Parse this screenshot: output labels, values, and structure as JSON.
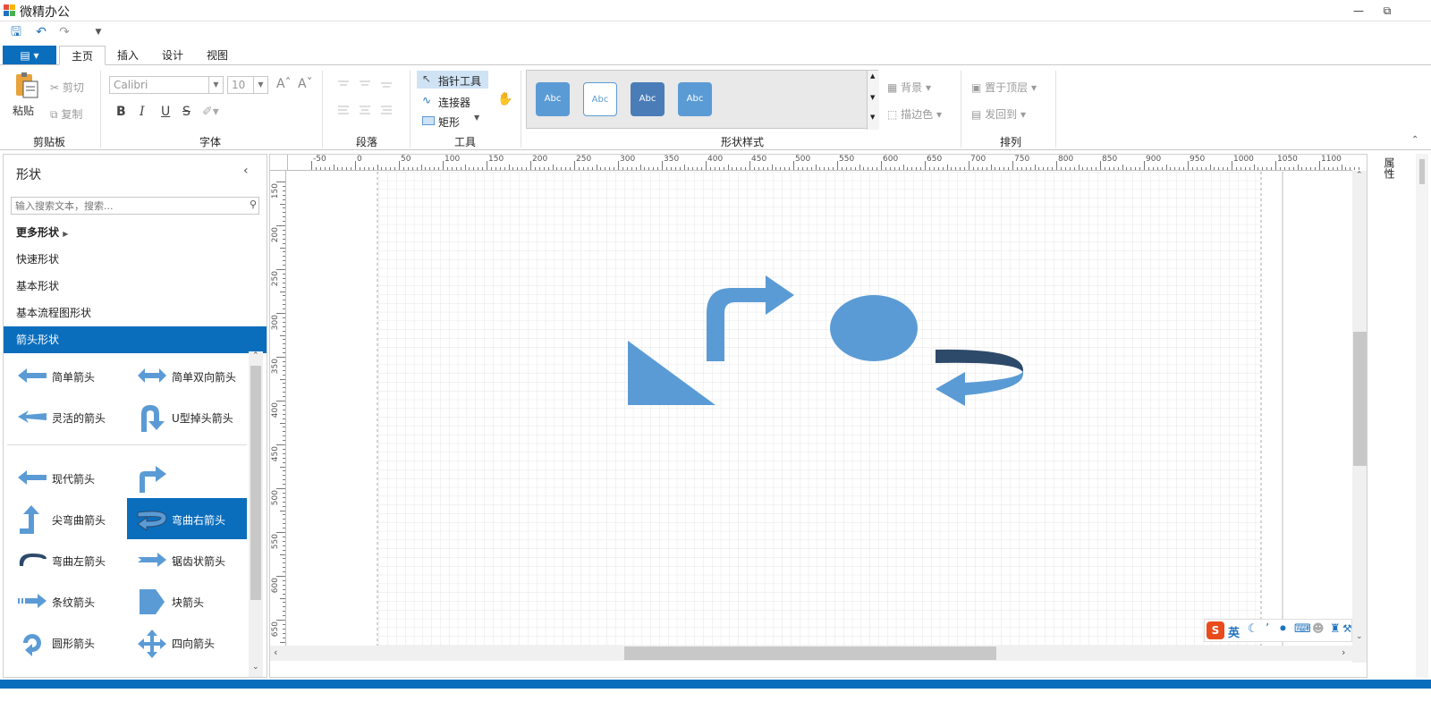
{
  "app": {
    "title": "微精办公",
    "window_buttons": [
      "minimize",
      "restore"
    ]
  },
  "qat": {
    "icons": [
      "save-icon",
      "undo-icon",
      "redo-icon",
      "customize-icon"
    ]
  },
  "tabs": [
    {
      "label": "主页",
      "active": true
    },
    {
      "label": "插入",
      "active": false
    },
    {
      "label": "设计",
      "active": false
    },
    {
      "label": "视图",
      "active": false
    }
  ],
  "ribbon": {
    "clipboard": {
      "group_label": "剪贴板",
      "paste": "粘贴",
      "cut": "剪切",
      "copy": "复制"
    },
    "font": {
      "group_label": "字体",
      "family": "Calibri",
      "size": "10",
      "bold": "B",
      "italic": "I",
      "underline": "U",
      "strike": "S"
    },
    "paragraph": {
      "group_label": "段落"
    },
    "tools": {
      "group_label": "工具",
      "pointer": "指针工具",
      "connector": "连接器",
      "rectangle": "矩形"
    },
    "shape_styles": {
      "group_label": "形状样式",
      "samples": [
        "Abc",
        "Abc",
        "Abc",
        "Abc"
      ],
      "background": "背景",
      "outline": "描边色"
    },
    "arrange": {
      "group_label": "排列",
      "bring_front": "置于顶层",
      "send_back": "发回到"
    }
  },
  "sidepanel": {
    "title": "形状",
    "search_placeholder": "输入搜索文本，搜索...",
    "categories": [
      {
        "label": "更多形状",
        "active": false
      },
      {
        "label": "快速形状",
        "active": false
      },
      {
        "label": "基本形状",
        "active": false
      },
      {
        "label": "基本流程图形状",
        "active": false
      },
      {
        "label": "箭头形状",
        "active": true
      }
    ],
    "shapes": [
      {
        "label": "简单箭头",
        "icon": "simple-arrow-icon"
      },
      {
        "label": "简单双向箭头",
        "icon": "double-arrow-icon"
      },
      {
        "label": "灵活的箭头",
        "icon": "flexible-arrow-icon"
      },
      {
        "label": "U型掉头箭头",
        "icon": "u-turn-arrow-icon"
      },
      {
        "label": "现代箭头",
        "icon": "modern-arrow-icon"
      },
      {
        "label": "",
        "icon": "bent-arrow-icon"
      },
      {
        "label": "尖弯曲箭头",
        "icon": "sharp-bent-arrow-icon"
      },
      {
        "label": "弯曲右箭头",
        "icon": "curved-right-arrow-icon",
        "active": true
      },
      {
        "label": "弯曲左箭头",
        "icon": "curved-left-arrow-icon"
      },
      {
        "label": "锯齿状箭头",
        "icon": "notched-arrow-icon"
      },
      {
        "label": "条纹箭头",
        "icon": "striped-arrow-icon"
      },
      {
        "label": "块箭头",
        "icon": "block-arrow-icon"
      },
      {
        "label": "圆形箭头",
        "icon": "circular-arrow-icon"
      },
      {
        "label": "四向箭头",
        "icon": "quad-arrow-icon"
      }
    ]
  },
  "canvas": {
    "h_ruler_labels": [
      "-50",
      "0",
      "50",
      "100",
      "150",
      "200",
      "250",
      "300",
      "350",
      "400",
      "450",
      "500",
      "550",
      "600",
      "650",
      "700",
      "750",
      "800",
      "850",
      "900",
      "950",
      "1000",
      "1050",
      "1100"
    ],
    "v_ruler_labels": [
      "150",
      "200",
      "250",
      "300",
      "350",
      "400",
      "450",
      "500",
      "550",
      "600",
      "650"
    ],
    "shapes": [
      "triangle",
      "bent-arrow",
      "ellipse",
      "curved-arrow"
    ]
  },
  "right_strip": {
    "label": "属性"
  },
  "ime": {
    "label": "英"
  },
  "colors": {
    "accent": "#0a6ebd",
    "shape_fill": "#5b9bd5",
    "shape_dark": "#2e4a6b"
  }
}
